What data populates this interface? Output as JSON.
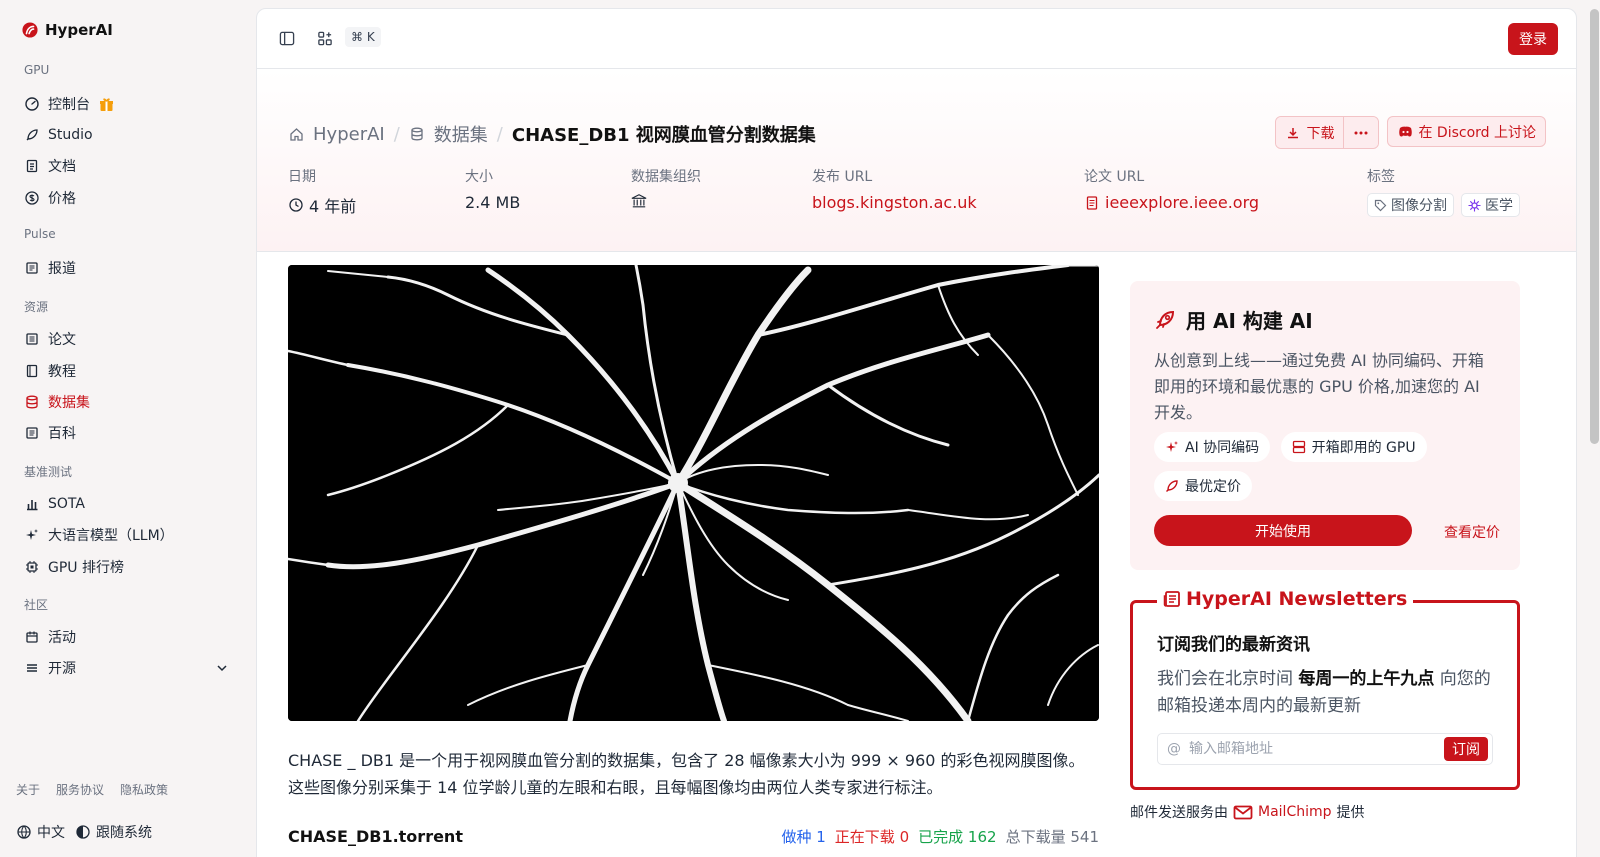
{
  "brand": {
    "name": "HyperAI"
  },
  "sidebar": {
    "sections": [
      {
        "title": "GPU",
        "items": [
          {
            "label": "控制台",
            "icon": "dashboard-icon",
            "badge": "gift-icon"
          },
          {
            "label": "Studio",
            "icon": "rocket-icon"
          },
          {
            "label": "文档",
            "icon": "doc-icon"
          },
          {
            "label": "价格",
            "icon": "dollar-icon"
          }
        ]
      },
      {
        "title": "Pulse",
        "items": [
          {
            "label": "报道",
            "icon": "news-icon"
          }
        ]
      },
      {
        "title": "资源",
        "items": [
          {
            "label": "论文",
            "icon": "paper-icon"
          },
          {
            "label": "教程",
            "icon": "book-icon"
          },
          {
            "label": "数据集",
            "icon": "database-icon",
            "active": true
          },
          {
            "label": "百科",
            "icon": "wiki-icon"
          }
        ]
      },
      {
        "title": "基准测试",
        "items": [
          {
            "label": "SOTA",
            "icon": "bar-chart-icon"
          },
          {
            "label": "大语言模型（LLM）",
            "icon": "sparkle-icon"
          },
          {
            "label": "GPU 排行榜",
            "icon": "chip-icon"
          }
        ]
      },
      {
        "title": "社区",
        "items": [
          {
            "label": "活动",
            "icon": "calendar-icon"
          },
          {
            "label": "开源",
            "icon": "menu-icon"
          }
        ]
      }
    ],
    "footer_links": [
      "关于",
      "服务协议",
      "隐私政策"
    ],
    "language": "中文",
    "theme": "跟随系统"
  },
  "topbar": {
    "shortcut": "⌘ K",
    "login": "登录"
  },
  "breadcrumb": {
    "home": "HyperAI",
    "datasets": "数据集",
    "current": "CHASE_DB1 视网膜血管分割数据集"
  },
  "actions": {
    "download": "下载",
    "discord": "在 Discord 上讨论"
  },
  "meta": {
    "date": {
      "label": "日期",
      "value": "4 年前"
    },
    "size": {
      "label": "大小",
      "value": "2.4 MB"
    },
    "org": {
      "label": "数据集组织"
    },
    "release": {
      "label": "发布 URL",
      "value": "blogs.kingston.ac.uk"
    },
    "paper": {
      "label": "论文 URL",
      "value": "ieeexplore.ieee.org"
    },
    "tags": {
      "label": "标签",
      "items": [
        "图像分割",
        "医学"
      ]
    }
  },
  "description": "CHASE _ DB1 是一个用于视网膜血管分割的数据集，包含了 28 幅像素大小为 999 × 960 的彩色视网膜图像。这些图像分别采集于 14 位学龄儿童的左眼和右眼，且每幅图像均由两位人类专家进行标注。",
  "torrent": {
    "name": "CHASE_DB1.torrent",
    "seed_label": "做种",
    "seed": "1",
    "downloading_label": "正在下载",
    "downloading": "0",
    "done_label": "已完成",
    "done": "162",
    "total_label": "总下载量",
    "total": "541"
  },
  "promo": {
    "title": "用 AI 构建 AI",
    "body": "从创意到上线——通过免费 AI 协同编码、开箱即用的环境和最优惠的 GPU 价格,加速您的 AI 开发。",
    "chips": [
      "AI 协同编码",
      "开箱即用的 GPU",
      "最优定价"
    ],
    "start": "开始使用",
    "pricing": "查看定价"
  },
  "newsletter": {
    "legend": "HyperAI Newsletters",
    "title": "订阅我们的最新资讯",
    "body_pre": "我们会在北京时间 ",
    "body_bold": "每周一的上午九点",
    "body_post": " 向您的邮箱投递本周内的最新更新",
    "placeholder": "输入邮箱地址",
    "subscribe": "订阅"
  },
  "mail_provider": {
    "pre": "邮件发送服务由",
    "name": "MailChimp",
    "post": "提供"
  },
  "colors": {
    "accent": "#c8141b",
    "seed": "#2563eb",
    "downloading": "#dc2626",
    "done": "#16a34a"
  }
}
